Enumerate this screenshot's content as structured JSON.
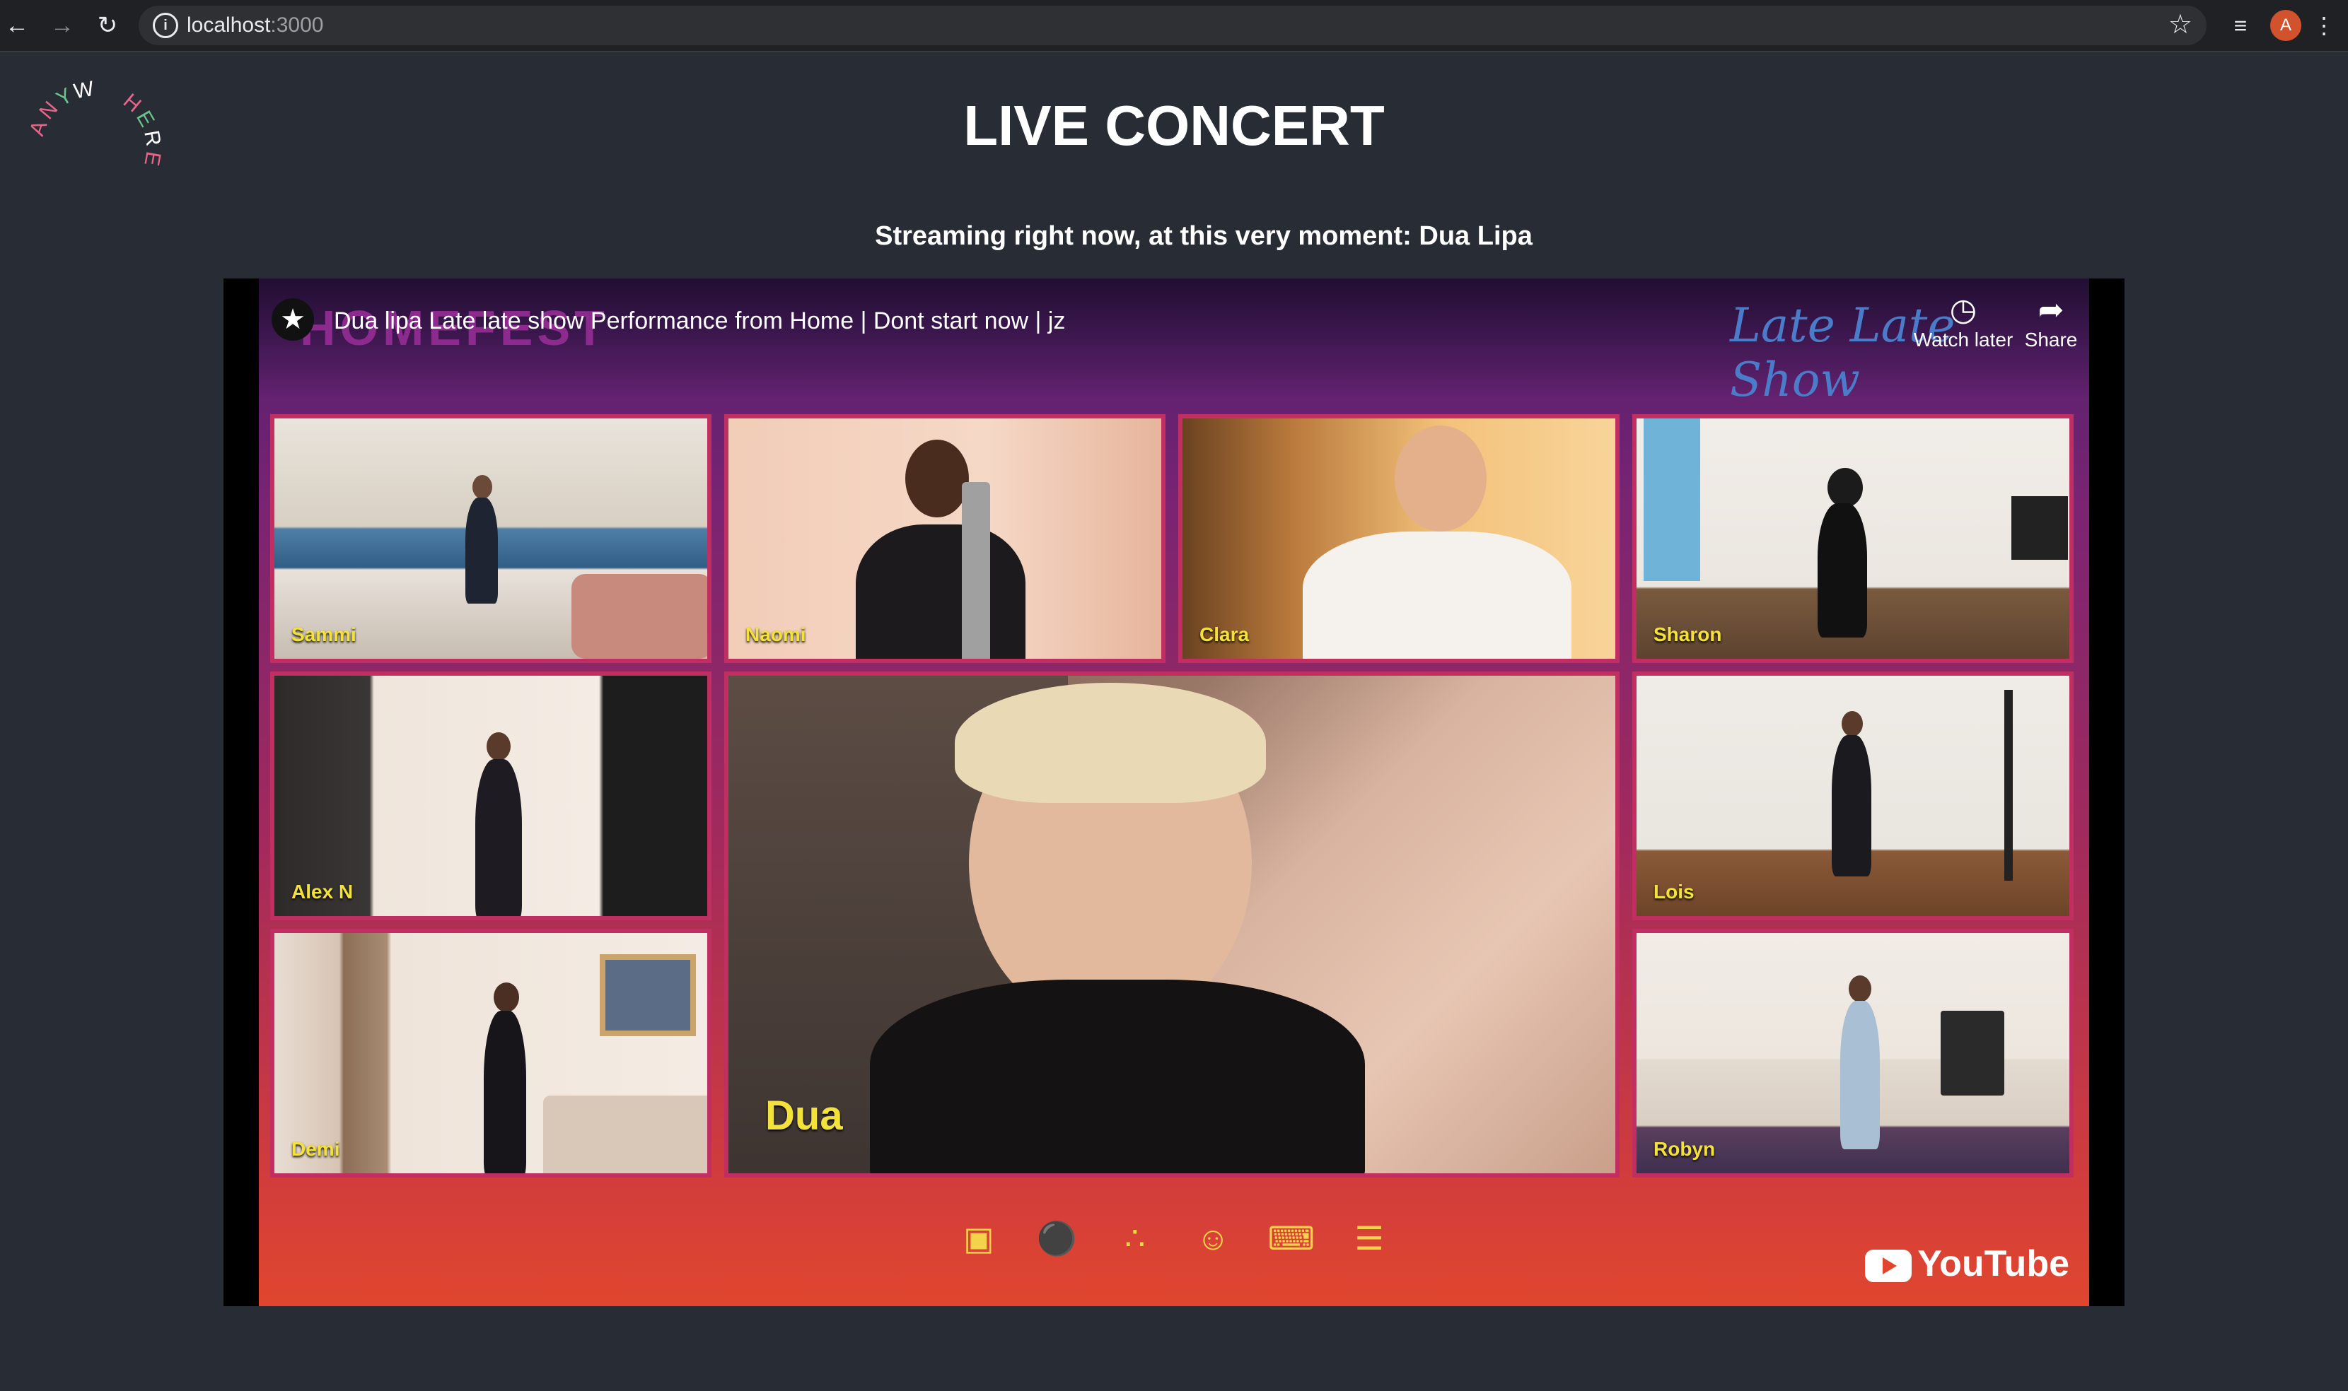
{
  "browser": {
    "back_icon": "arrow-left-icon",
    "forward_icon": "arrow-right-icon",
    "reload_icon": "reload-icon",
    "url_host": "localhost",
    "url_port": ":3000",
    "avatar_letter": "A"
  },
  "page": {
    "logo_letters": [
      "A",
      "N",
      "Y",
      "W",
      "H",
      "E",
      "R",
      "E"
    ],
    "logo_colors": [
      "#e8658a",
      "#e8658a",
      "#6cc38b",
      "#ffffff",
      "#e8658a",
      "#6cc38b",
      "#ffffff",
      "#e8658a"
    ],
    "title": "LIVE CONCERT",
    "subtitle": "Streaming right now, at this very moment: Dua Lipa"
  },
  "player": {
    "title": "Dua lipa Late late show Performance from Home | Dont start now | jz",
    "show_brand": "Late Late Show",
    "overlay_text": "HOMEFEST",
    "watch_later_label": "Watch later",
    "share_label": "Share",
    "youtube_label": "YouTube",
    "participants": {
      "sammi": "Sammi",
      "naomi": "Naomi",
      "clara": "Clara",
      "sharon": "Sharon",
      "alex": "Alex N",
      "dua": "Dua",
      "lois": "Lois",
      "demi": "Demi",
      "robyn": "Robyn"
    },
    "toolbar_icons": [
      "video-camera-icon",
      "microphone-icon",
      "share-nodes-icon",
      "person-icon",
      "chat-icon",
      "sliders-icon"
    ]
  }
}
